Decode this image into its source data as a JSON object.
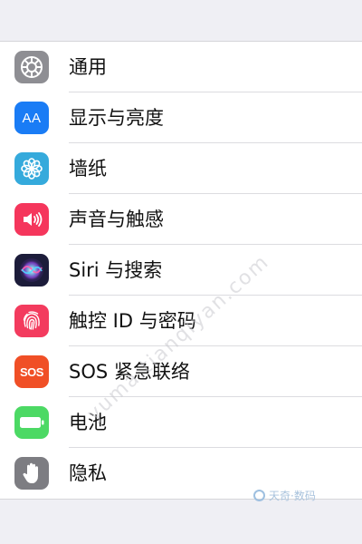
{
  "settings": {
    "items": [
      {
        "id": "general",
        "label": "通用",
        "icon": "gear-icon",
        "color": "#8e8e93"
      },
      {
        "id": "display",
        "label": "显示与亮度",
        "icon": "text-size-icon",
        "icon_text": "AA",
        "color": "#1a7cf5"
      },
      {
        "id": "wallpaper",
        "label": "墙纸",
        "icon": "flower-icon",
        "color": "#35aadc"
      },
      {
        "id": "sounds",
        "label": "声音与触感",
        "icon": "speaker-icon",
        "color": "#f5365c"
      },
      {
        "id": "siri",
        "label": "Siri 与搜索",
        "icon": "siri-icon",
        "color": "#1c1c3a"
      },
      {
        "id": "touchid",
        "label": "触控 ID 与密码",
        "icon": "fingerprint-icon",
        "color": "#f33b5e"
      },
      {
        "id": "sos",
        "label": "SOS 紧急联络",
        "icon": "sos-icon",
        "icon_text": "SOS",
        "color": "#f04f26"
      },
      {
        "id": "battery",
        "label": "电池",
        "icon": "battery-icon",
        "color": "#4cd964"
      },
      {
        "id": "privacy",
        "label": "隐私",
        "icon": "hand-icon",
        "color": "#7d7d82"
      }
    ]
  },
  "watermark": {
    "text": "yuma.tianqiyan.com"
  },
  "logo": {
    "text": "天奇·数码"
  }
}
